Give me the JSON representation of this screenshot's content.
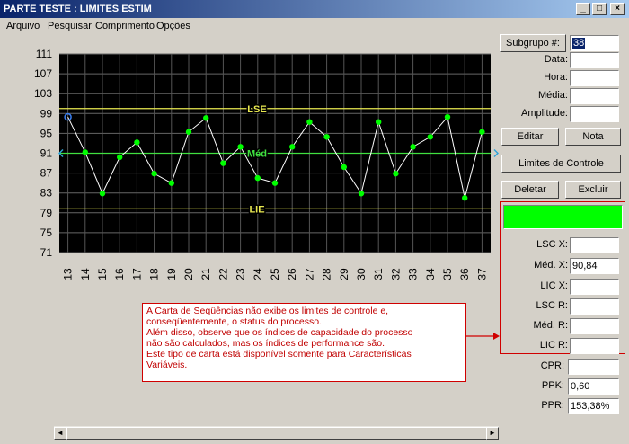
{
  "window": {
    "title": "PARTE TESTE : LIMITES ESTIM",
    "min_glyph": "_",
    "max_glyph": "□",
    "close_glyph": "×"
  },
  "menu": [
    "Arquivo",
    "Pesquisar",
    "Comprimento",
    "Opções"
  ],
  "chart_data": {
    "type": "line",
    "x": [
      13,
      14,
      15,
      16,
      17,
      18,
      19,
      20,
      21,
      22,
      23,
      24,
      25,
      26,
      27,
      28,
      29,
      30,
      31,
      32,
      33,
      34,
      35,
      36,
      37
    ],
    "values": [
      98.3,
      91.2,
      82.9,
      90.2,
      93.2,
      86.9,
      85.0,
      95.3,
      98.1,
      89.0,
      92.3,
      86.0,
      85.0,
      92.3,
      97.3,
      94.3,
      88.2,
      82.9,
      97.3,
      86.9,
      92.3,
      94.3,
      98.3,
      82.0,
      95.3
    ],
    "ylim": [
      71,
      111
    ],
    "yticks": [
      111,
      107,
      103,
      99,
      95,
      91,
      87,
      83,
      79,
      75,
      71
    ],
    "reference_lines": [
      {
        "label": "LSE",
        "value": 100.0,
        "color": "#e8e850"
      },
      {
        "label": "Méd",
        "value": 91.0,
        "color": "#40e040"
      },
      {
        "label": "LIE",
        "value": 79.8,
        "color": "#e8e850"
      }
    ],
    "plot_background": "#000000",
    "line_color": "#ffffff",
    "point_color": "#00ff00",
    "first_point_color": "#3a7ff0",
    "marker_color": "#2fa4d8",
    "grid": true
  },
  "panel": {
    "subgrupo_label": "Subgrupo #:",
    "subgrupo_value": "38",
    "fields_top": [
      {
        "label": "Data:",
        "value": ""
      },
      {
        "label": "Hora:",
        "value": ""
      },
      {
        "label": "Média:",
        "value": ""
      },
      {
        "label": "Amplitude:",
        "value": ""
      }
    ],
    "buttons": {
      "editar": "Editar",
      "nota": "Nota",
      "limites": "Limites de Controle",
      "deletar": "Deletar",
      "excluir": "Excluir"
    },
    "status_color": "#00ff00",
    "limits": [
      {
        "label": "LSC X:",
        "value": ""
      },
      {
        "label": "Méd. X:",
        "value": "90,84"
      },
      {
        "label": "LIC X:",
        "value": ""
      },
      {
        "label": "LSC R:",
        "value": ""
      },
      {
        "label": "Méd. R:",
        "value": ""
      },
      {
        "label": "LIC R:",
        "value": ""
      }
    ],
    "indices": [
      {
        "label": "CPR:",
        "value": ""
      },
      {
        "label": "PPK:",
        "value": "0,60"
      },
      {
        "label": "PPR:",
        "value": "153,38%"
      }
    ]
  },
  "note": {
    "lines": [
      "A Carta de Seqüências não exibe os limites de controle e,",
      "conseqüentemente, o status do processo.",
      "Além disso, observe que os índices de capacidade do processo",
      "não são calculados, mas os índices de performance são.",
      "Este tipo de carta está disponível somente para Características",
      "Variáveis."
    ],
    "border_color": "#d00000"
  },
  "scrollbar": {
    "left_arrow": "◄",
    "right_arrow": "►"
  }
}
